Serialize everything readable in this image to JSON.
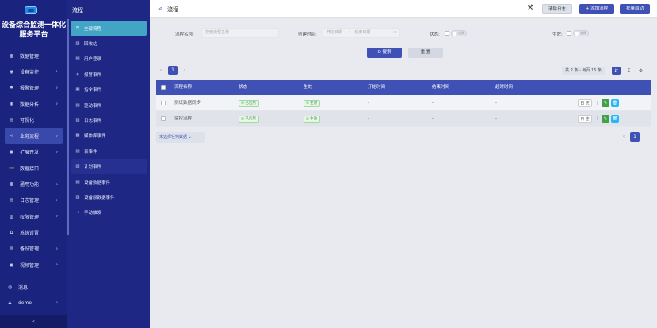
{
  "app": {
    "title_line1": "设备综合监测一体化",
    "title_line2": "服务平台"
  },
  "sidebar": {
    "items": [
      {
        "label": "数据管理",
        "icon": "grid-icon",
        "arrow": false
      },
      {
        "label": "设备监控",
        "icon": "monitor-icon",
        "arrow": true
      },
      {
        "label": "报警管理",
        "icon": "bell-icon",
        "arrow": true
      },
      {
        "label": "数据分析",
        "icon": "bar-chart-icon",
        "arrow": true
      },
      {
        "label": "可视化",
        "icon": "layout-icon",
        "arrow": false
      },
      {
        "label": "业务流程",
        "icon": "share-icon",
        "arrow": true,
        "active": true
      },
      {
        "label": "扩展开发",
        "icon": "code-icon",
        "arrow": true
      },
      {
        "label": "数据接口",
        "icon": "api-icon",
        "arrow": false
      },
      {
        "label": "通用功能",
        "icon": "apps-icon",
        "arrow": true
      },
      {
        "label": "日志管理",
        "icon": "log-icon",
        "arrow": true
      },
      {
        "label": "权限管理",
        "icon": "lock-icon",
        "arrow": true
      },
      {
        "label": "系统设置",
        "icon": "gear-icon",
        "arrow": false
      },
      {
        "label": "备份管理",
        "icon": "backup-icon",
        "arrow": true
      },
      {
        "label": "视频管理",
        "icon": "video-icon",
        "arrow": true
      }
    ],
    "bottom": [
      {
        "label": "消息",
        "icon": "message-icon"
      },
      {
        "label": "demo",
        "icon": "user-icon"
      }
    ],
    "collapse_glyph": "‹"
  },
  "subside": {
    "title": "流程",
    "items": [
      {
        "label": "全部流程",
        "icon": "list-icon",
        "active": true
      },
      {
        "label": "回收站",
        "icon": "trash-icon"
      },
      {
        "label": "用户登录",
        "icon": "login-icon"
      },
      {
        "label": "报警事件",
        "icon": "alarm-icon"
      },
      {
        "label": "指令事件",
        "icon": "command-icon"
      },
      {
        "label": "驱动事件",
        "icon": "driver-icon"
      },
      {
        "label": "日志事件",
        "icon": "log-event-icon"
      },
      {
        "label": "媒体库事件",
        "icon": "media-icon"
      },
      {
        "label": "表事件",
        "icon": "table-icon"
      },
      {
        "label": "计划事件",
        "icon": "schedule-icon",
        "hover": true
      },
      {
        "label": "设备数据事件",
        "icon": "device-data-icon"
      },
      {
        "label": "设备原数据事件",
        "icon": "raw-data-icon"
      },
      {
        "label": "手动触发",
        "icon": "manual-trigger-icon"
      }
    ]
  },
  "header": {
    "title": "流程",
    "clear_log": "清除日志",
    "add_flow": "+ 添加流程",
    "batch_start": "批量启动"
  },
  "filter": {
    "name_label": "流程名称:",
    "name_placeholder": "搜索流程名称",
    "time_label": "创建时间:",
    "start_placeholder": "开始日期",
    "range_sep": "→",
    "end_placeholder": "结束日期",
    "status_label": "状态:",
    "status_toggle_text": "关闭",
    "effective_label": "生效:",
    "effective_toggle_text": "关闭",
    "search": "Q 搜索",
    "reset": "重 置"
  },
  "pager": {
    "current": "1",
    "prev": "‹",
    "next": "›",
    "info": "共 2 条 - 每页 15 条"
  },
  "table": {
    "columns": [
      "流程名称",
      "状态",
      "生效",
      "开始时间",
      "结束时间",
      "超时时间"
    ],
    "rows": [
      {
        "name": "测试数据同步",
        "status": "已启用",
        "effective": "生效",
        "start": "-",
        "end": "-",
        "timeout": "-"
      },
      {
        "name": "监控流程",
        "status": "已启用",
        "effective": "生效",
        "start": "-",
        "end": "-",
        "timeout": "-"
      }
    ],
    "actions": {
      "log": "日 志",
      "copy": "▯",
      "edit": "✎",
      "delete": "🗑"
    }
  },
  "footer": {
    "select_none": "未选择任何数据 ⌄",
    "page": "1",
    "prev": "‹"
  }
}
